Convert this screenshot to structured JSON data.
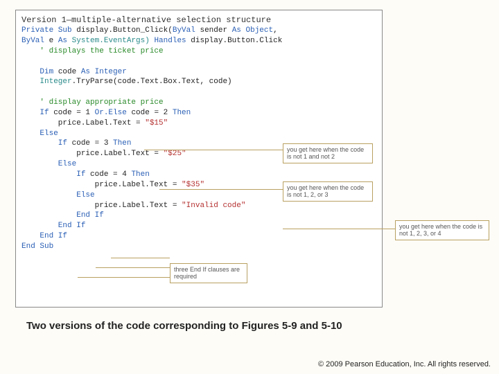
{
  "header": "Version 1—multiple-alternative selection structure",
  "code": {
    "l1a": "Private Sub",
    "l1b": " display.Button_Click(",
    "l1c": "ByVal",
    "l1d": " sender ",
    "l1e": "As Object",
    "l1f": ",",
    "l2a": "ByVal",
    "l2b": " e ",
    "l2c": "As",
    "l2d": " System.EventArgs) ",
    "l2e": "Handles",
    "l2f": " display.Button.Click",
    "l3": "    ' displays the ticket price",
    "l5a": "    Dim",
    "l5b": " code ",
    "l5c": "As Integer",
    "l6a": "    Integer",
    "l6b": ".TryParse(code.Text.Box.Text, code)",
    "l8": "    ' display appropriate price",
    "l9a": "    If",
    "l9b": " code = 1 ",
    "l9c": "Or.Else",
    "l9d": " code = 2 ",
    "l9e": "Then",
    "l10a": "        price.Label.Text = ",
    "l10b": "\"$15\"",
    "l11": "    Else",
    "l12a": "        If",
    "l12b": " code = 3 ",
    "l12c": "Then",
    "l13a": "            price.Label.Text = ",
    "l13b": "\"$25\"",
    "l14": "        Else",
    "l15a": "            If",
    "l15b": " code = 4 ",
    "l15c": "Then",
    "l16a": "                price.Label.Text = ",
    "l16b": "\"$35\"",
    "l17": "            Else",
    "l18a": "                price.Label.Text = ",
    "l18b": "\"Invalid code\"",
    "l19": "            End If",
    "l20": "        End If",
    "l21": "    End If",
    "l22": "End Sub"
  },
  "annot": {
    "a1": "you get here when the code is not 1 and not 2",
    "a2": "you get here when the code is not 1, 2, or 3",
    "a3": "you get here when the code is not 1, 2, 3, or 4",
    "a4": "three End If clauses are required"
  },
  "caption": "Two versions of the code corresponding to Figures 5-9 and 5-10",
  "copyright": "© 2009 Pearson Education, Inc.  All rights reserved."
}
